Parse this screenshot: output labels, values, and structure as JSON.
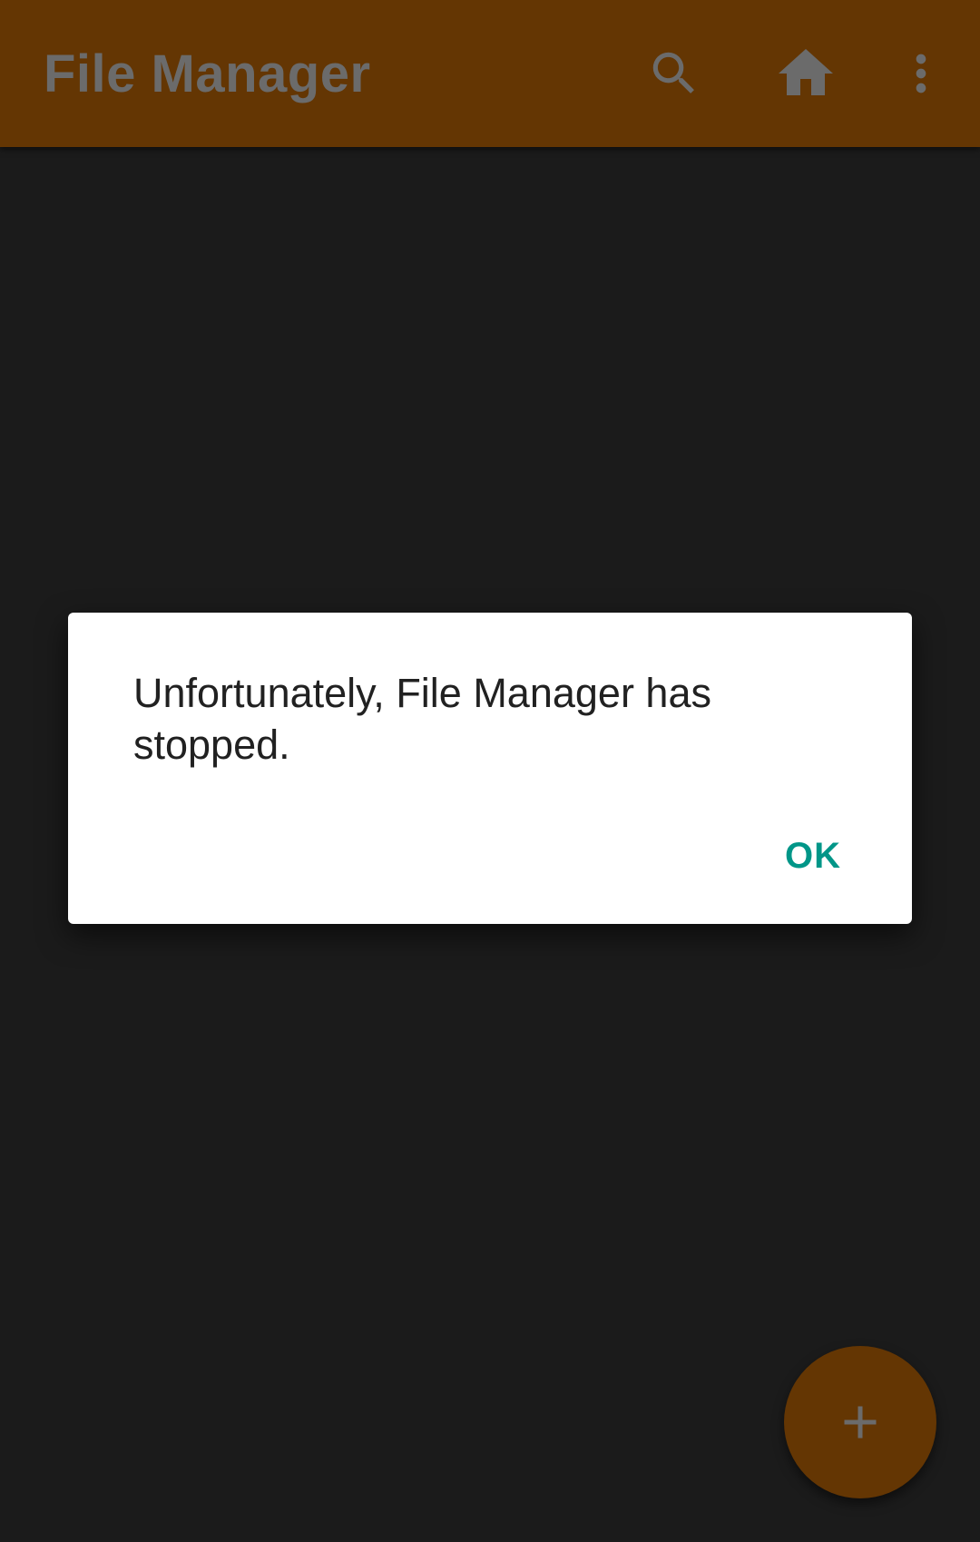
{
  "app_bar": {
    "title": "File Manager",
    "actions": [
      {
        "icon": "search-icon"
      },
      {
        "icon": "home-icon"
      },
      {
        "icon": "more-vert-icon"
      }
    ],
    "background": "#643603"
  },
  "dialog": {
    "message": "Unfortunately, File Manager has stopped.",
    "ok_label": "OK",
    "accent": "#009688"
  },
  "fab": {
    "icon": "plus-icon"
  }
}
